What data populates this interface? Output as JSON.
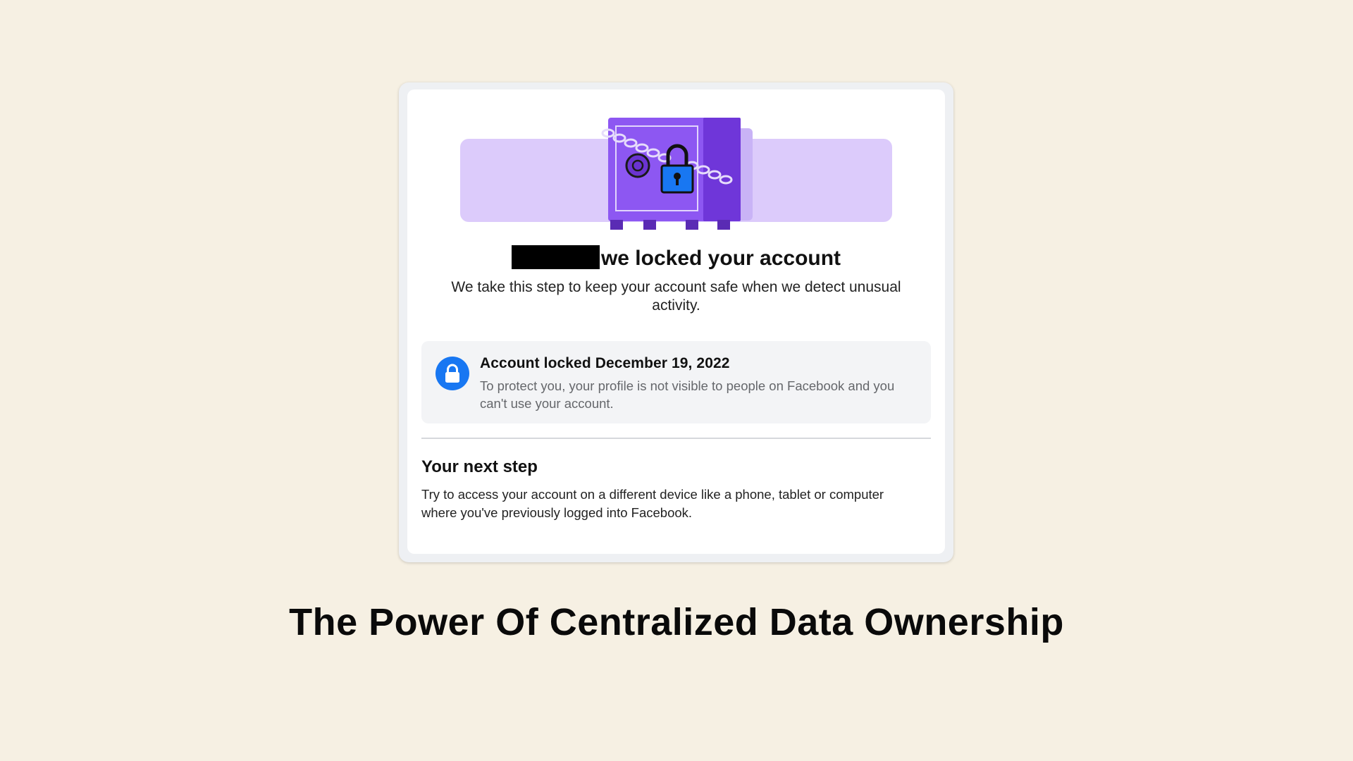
{
  "card": {
    "headline": "we locked your account",
    "subline": "We take this step to keep your account safe when we detect unusual activity.",
    "info": {
      "icon": "lock-icon",
      "title": "Account locked December 19, 2022",
      "text": "To protect you, your profile is not visible to people on Facebook and you can't use your account."
    },
    "next_step": {
      "title": "Your next step",
      "text": "Try to access your account on a different device like a phone, tablet or computer where you've previously logged into Facebook."
    }
  },
  "caption": "The Power Of Centralized Data Ownership",
  "colors": {
    "background": "#f6f0e3",
    "banner": "#dccbfb",
    "safe": "#8d57f2",
    "lock_blue": "#1877f2"
  }
}
